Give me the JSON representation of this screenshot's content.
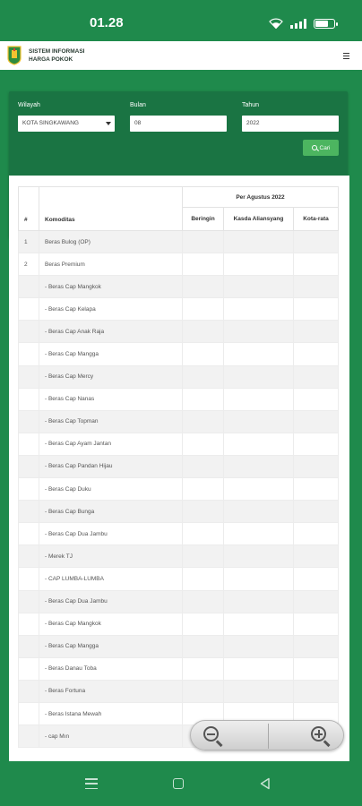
{
  "status_bar": {
    "time": "01.28",
    "icons": [
      "wifi-icon",
      "signal-icon",
      "battery-icon"
    ],
    "battery_level": 0.75
  },
  "header": {
    "title_line1": "SISTEM INFORMASI",
    "title_line2": "HARGA POKOK",
    "logo": "kalimantan-barat-crest-logo",
    "menu_icon": "hamburger-menu-icon"
  },
  "filters": {
    "wilayah_label": "Wilayah",
    "wilayah_value": "KOTA SINGKAWANG",
    "bulan_label": "Bulan",
    "bulan_value": "08",
    "tahun_label": "Tahun",
    "tahun_value": "2022",
    "search_button": "Cari"
  },
  "table": {
    "col_no": "#",
    "col_komoditas": "Komoditas",
    "group_header": "Per Agustus 2022",
    "sub_headers": [
      "Beringin",
      "Kasda Aliansyang",
      "Kota-rata"
    ],
    "rows": [
      {
        "no": "1",
        "name": "Beras Bulog (OP)"
      },
      {
        "no": "2",
        "name": "Beras Premium"
      },
      {
        "no": "",
        "name": "- Beras Cap Mangkok"
      },
      {
        "no": "",
        "name": "- Beras Cap Kelapa"
      },
      {
        "no": "",
        "name": "- Beras Cap Anak Raja"
      },
      {
        "no": "",
        "name": "- Beras Cap Mangga"
      },
      {
        "no": "",
        "name": "- Beras Cap Mercy"
      },
      {
        "no": "",
        "name": "- Beras Cap Nanas"
      },
      {
        "no": "",
        "name": "- Beras Cap Topman"
      },
      {
        "no": "",
        "name": "- Beras Cap Ayam Jantan"
      },
      {
        "no": "",
        "name": "- Beras Cap Pandan Hijau"
      },
      {
        "no": "",
        "name": "- Beras Cap Duku"
      },
      {
        "no": "",
        "name": "- Beras Cap Bunga"
      },
      {
        "no": "",
        "name": "- Beras Cap Dua Jambu"
      },
      {
        "no": "",
        "name": "- Merek TJ"
      },
      {
        "no": "",
        "name": "- CAP LUMBA-LUMBA"
      },
      {
        "no": "",
        "name": "- Beras Cap Dua Jambu"
      },
      {
        "no": "",
        "name": "- Beras Cap Mangkok"
      },
      {
        "no": "",
        "name": "- Beras Cap Mangga"
      },
      {
        "no": "",
        "name": "- Beras Danau Toba"
      },
      {
        "no": "",
        "name": "- Beras Fortuna"
      },
      {
        "no": "",
        "name": "- Beras Istana Mewah"
      },
      {
        "no": "",
        "name": "- cap Mın"
      }
    ]
  },
  "zoom": {
    "out_icon": "zoom-out-icon",
    "in_icon": "zoom-in-icon"
  },
  "nav_bar": {
    "icons": [
      "recent-apps-icon",
      "home-icon",
      "back-icon"
    ]
  },
  "colors": {
    "primary_green": "#1f8a4c",
    "filter_card": "#1a7443",
    "button_green": "#4cb560"
  }
}
